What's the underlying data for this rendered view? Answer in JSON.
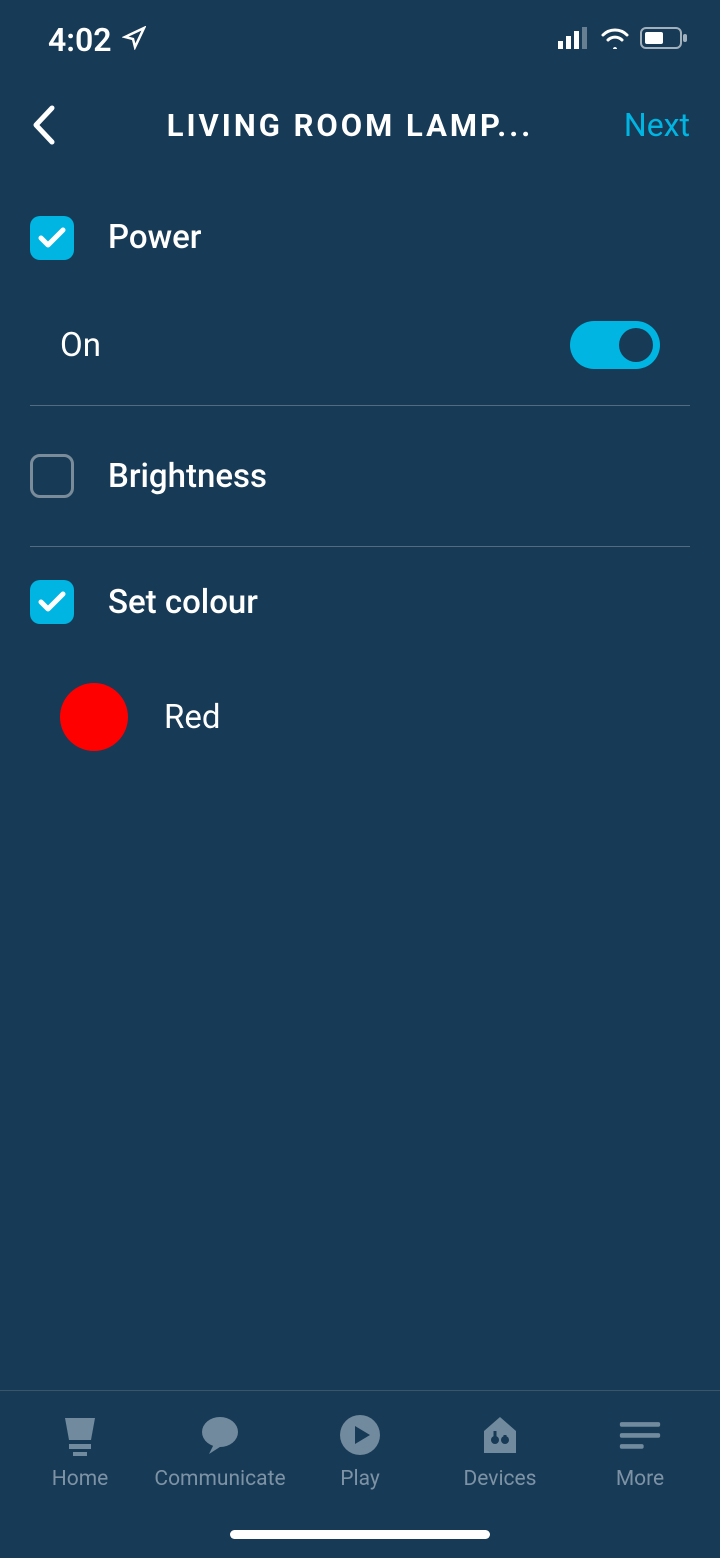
{
  "status": {
    "time": "4:02"
  },
  "header": {
    "title": "LIVING ROOM LAMP...",
    "next_label": "Next"
  },
  "settings": {
    "power": {
      "label": "Power",
      "checked": true,
      "sub_label": "On",
      "toggle_on": true
    },
    "brightness": {
      "label": "Brightness",
      "checked": false
    },
    "set_colour": {
      "label": "Set colour",
      "checked": true,
      "color_name": "Red",
      "color_hex": "#ff0000"
    }
  },
  "nav": {
    "items": [
      {
        "label": "Home"
      },
      {
        "label": "Communicate"
      },
      {
        "label": "Play"
      },
      {
        "label": "Devices"
      },
      {
        "label": "More"
      }
    ]
  }
}
